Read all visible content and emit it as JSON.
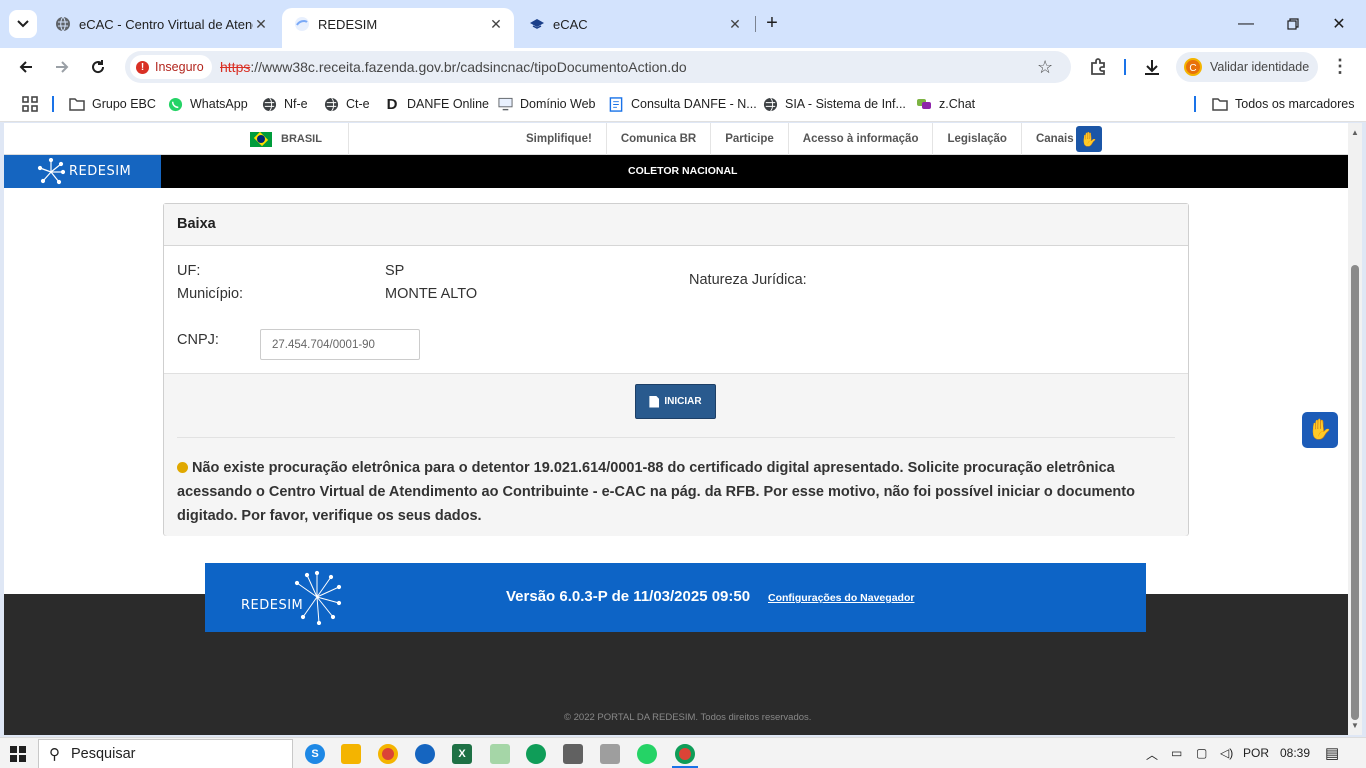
{
  "browser": {
    "tabs": [
      {
        "title": "eCAC - Centro Virtual de Atend",
        "active": false
      },
      {
        "title": "REDESIM",
        "active": true
      },
      {
        "title": "eCAC",
        "active": false
      }
    ],
    "security_label": "Inseguro",
    "url_scheme": "https",
    "url_rest": "://www38c.receita.fazenda.gov.br/cadsincnac/tipoDocumentoAction.do",
    "profile_button": "Validar identidade"
  },
  "bookmarks": {
    "items": [
      {
        "label": "Grupo EBC",
        "icon": "folder-icon"
      },
      {
        "label": "WhatsApp",
        "icon": "whatsapp-icon"
      },
      {
        "label": "Nf-e",
        "icon": "globe-icon"
      },
      {
        "label": "Ct-e",
        "icon": "globe-icon"
      },
      {
        "label": "DANFE Online",
        "icon": "danfe-icon"
      },
      {
        "label": "Domínio Web",
        "icon": "monitor-icon"
      },
      {
        "label": "Consulta DANFE - N...",
        "icon": "document-icon"
      },
      {
        "label": "SIA - Sistema de Inf...",
        "icon": "globe-icon"
      },
      {
        "label": "z.Chat",
        "icon": "chat-icon"
      }
    ],
    "all_bookmarks": "Todos os marcadores"
  },
  "gov_bar": {
    "country": "BRASIL",
    "links": [
      "Simplifique!",
      "Comunica BR",
      "Participe",
      "Acesso à informação",
      "Legislação",
      "Canais"
    ]
  },
  "header": {
    "logo_text": "REDESIM",
    "title": "COLETOR NACIONAL"
  },
  "form": {
    "section_title": "Baixa",
    "uf_label": "UF:",
    "uf_value": "SP",
    "municipio_label": "Município:",
    "municipio_value": "MONTE ALTO",
    "natureza_label": "Natureza Jurídica:",
    "cnpj_label": "CNPJ:",
    "cnpj_value": "27.454.704/0001-90",
    "start_button": "INICIAR",
    "warning_message": "Não existe procuração eletrônica para o detentor 19.021.614/0001-88 do certificado digital apresentado. Solicite procuração eletrônica acessando o Centro Virtual de Atendimento ao Contribuinte - e-CAC na pág. da RFB. Por esse motivo, não foi possível iniciar o documento digitado. Por favor, verifique os seus dados."
  },
  "footer": {
    "logo_text": "REDESIM",
    "version": "Versão 6.0.3-P de 11/03/2025 09:50",
    "config_link": "Configurações do Navegador",
    "copyright": "2022 PORTAL DA REDESIM. Todos direitos reservados."
  },
  "taskbar": {
    "search_placeholder": "Pesquisar",
    "language": "POR",
    "time": "08:39"
  },
  "colors": {
    "brand_blue": "#0d64c6",
    "button_blue": "#295a8e",
    "warning_yellow": "#e0a800"
  }
}
